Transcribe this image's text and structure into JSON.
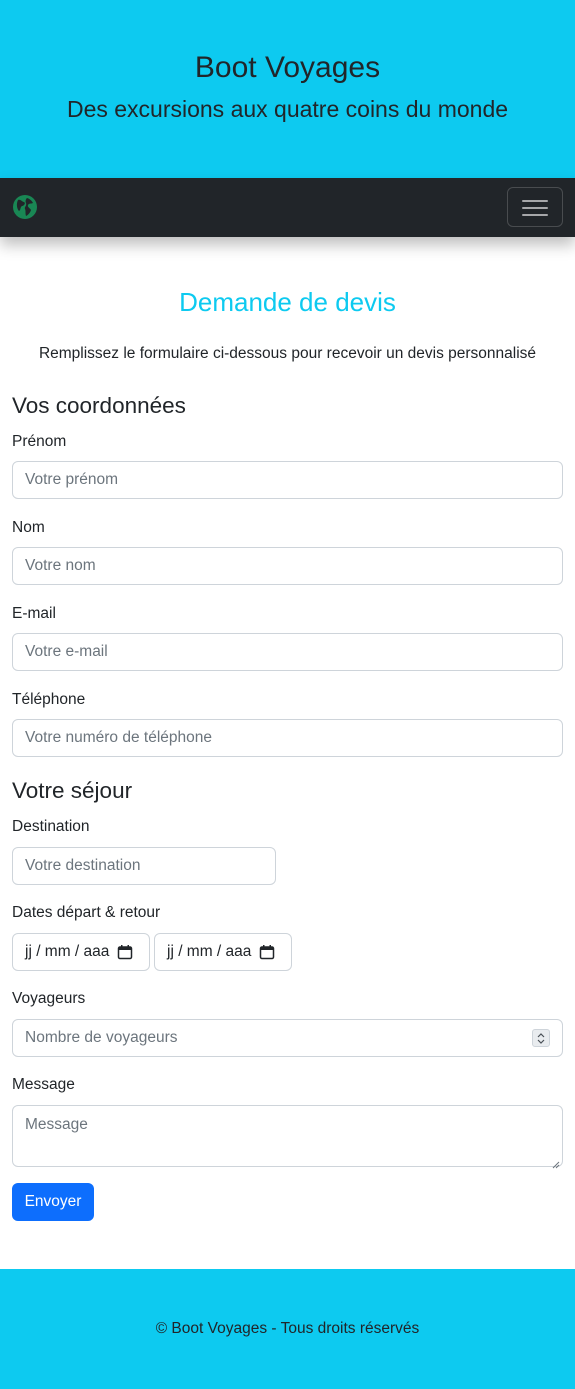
{
  "header": {
    "title": "Boot Voyages",
    "subtitle": "Des excursions aux quatre coins du monde"
  },
  "navbar": {
    "logo_icon": "globe-icon",
    "toggler_icon": "hamburger-menu-icon"
  },
  "form": {
    "title": "Demande de devis",
    "intro": "Remplissez le formulaire ci-dessous pour recevoir un devis personnalisé",
    "section_contact": "Vos coordonnées",
    "firstname": {
      "label": "Prénom",
      "placeholder": "Votre prénom"
    },
    "lastname": {
      "label": "Nom",
      "placeholder": "Votre nom"
    },
    "email": {
      "label": "E-mail",
      "placeholder": "Votre e-mail"
    },
    "phone": {
      "label": "Téléphone",
      "placeholder": "Votre numéro de téléphone"
    },
    "section_stay": "Votre séjour",
    "destination": {
      "label": "Destination",
      "placeholder": "Votre destination"
    },
    "dates": {
      "label": "Dates départ & retour",
      "departure_format": "jj / mm / aaa",
      "return_format": "jj / mm / aaa"
    },
    "travelers": {
      "label": "Voyageurs",
      "placeholder": "Nombre de voyageurs"
    },
    "message": {
      "label": "Message",
      "placeholder": "Message"
    },
    "submit_label": "Envoyer"
  },
  "footer": {
    "text": "© Boot Voyages - Tous droits réservés"
  },
  "colors": {
    "brand": "#0dcaf0",
    "navbar": "#212529",
    "primary_button": "#0d6efd"
  }
}
